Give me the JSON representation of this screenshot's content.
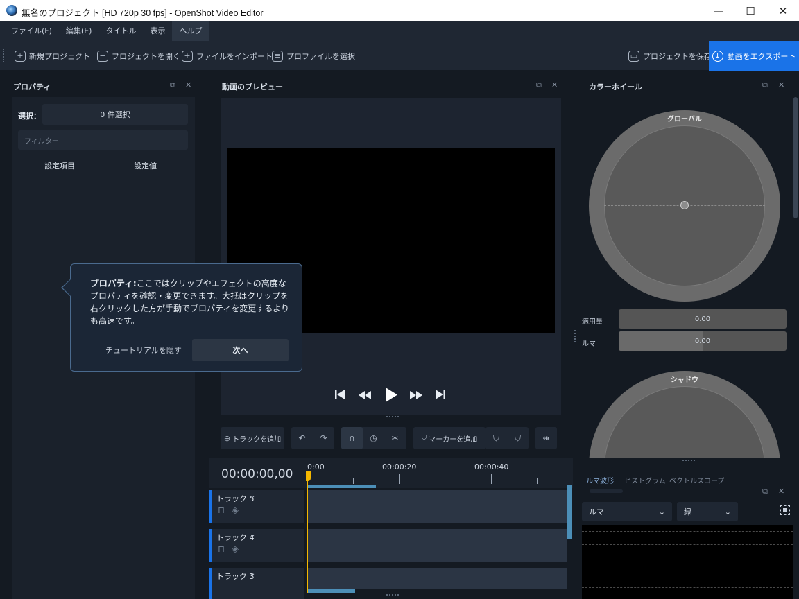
{
  "window": {
    "title": "無名のプロジェクト [HD 720p 30 fps] - OpenShot Video Editor",
    "minimize": "—",
    "maximize": "☐",
    "close": "✕"
  },
  "menu": [
    "ファイル(F)",
    "編集(E)",
    "タイトル",
    "表示",
    "ヘルプ"
  ],
  "toolbar": {
    "new_project": "新規プロジェクト",
    "open_project": "プロジェクトを開く",
    "import_files": "ファイルをインポート",
    "choose_profile": "プロファイルを選択",
    "save_project": "プロジェクトを保存",
    "export_video": "動画をエクスポート"
  },
  "properties": {
    "title": "プロパティ",
    "selection_label": "選択：",
    "selection_value": "0 件選択",
    "filter_placeholder": "フィルター",
    "col_property": "設定項目",
    "col_value": "設定値"
  },
  "preview": {
    "title": "動画のプレビュー"
  },
  "timeline": {
    "add_track": "トラックを追加",
    "add_marker": "マーカーを追加",
    "timecode": "00:00:00,00",
    "ruler": [
      "0:00",
      "00:00:20",
      "00:00:40"
    ],
    "tracks": [
      {
        "name": "トラック 5"
      },
      {
        "name": "トラック 4"
      },
      {
        "name": "トラック 3"
      }
    ]
  },
  "color_wheel": {
    "title": "カラーホイール",
    "global_label": "グローバル",
    "shadow_label": "シャドウ",
    "amount_label": "適用量",
    "amount_value": "0.00",
    "luma_label": "ルマ",
    "luma_value": "0.00"
  },
  "scopes": {
    "tabs": [
      "ルマ波形",
      "ヒストグラム",
      "ベクトルスコープ"
    ],
    "mode_select": "ルマ",
    "color_select": "緑"
  },
  "tutorial": {
    "heading": "プロパティ:",
    "body": "ここではクリップやエフェクトの高度なプロパティを確認・変更できます。大抵はクリップを右クリックした方が手動でプロパティを変更するよりも高速です。",
    "hide": "チュートリアルを隠す",
    "next": "次へ"
  },
  "colors": {
    "accent": "#1a73e8",
    "playhead": "#f5b800",
    "background": "#141a22"
  }
}
